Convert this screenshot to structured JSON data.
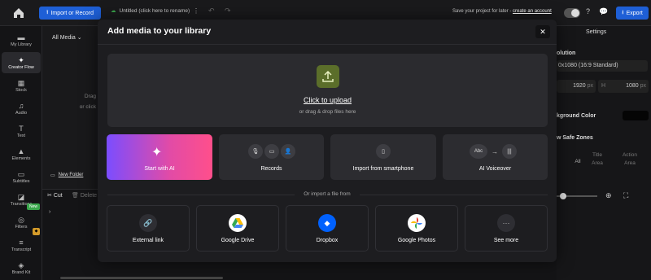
{
  "topbar": {
    "import_label": "Import or Record",
    "project_title": "Untitled (click here to rename)",
    "save_prompt": "Save your project for later - ",
    "create_account": "create an account",
    "export_label": "Export"
  },
  "sidebar": {
    "items": [
      {
        "label": "My Library",
        "icon": "folder-icon"
      },
      {
        "label": "Creator Flow",
        "icon": "sparkle-icon"
      },
      {
        "label": "Stock",
        "icon": "grid-icon"
      },
      {
        "label": "Audio",
        "icon": "music-icon"
      },
      {
        "label": "Text",
        "icon": "text-icon"
      },
      {
        "label": "Elements",
        "icon": "shapes-icon"
      },
      {
        "label": "Subtitles",
        "icon": "cc-icon"
      },
      {
        "label": "Transitions",
        "icon": "transition-icon"
      },
      {
        "label": "Filters",
        "icon": "filter-icon"
      },
      {
        "label": "Transcript",
        "icon": "transcript-icon"
      },
      {
        "label": "Brand Kit",
        "icon": "brand-icon"
      }
    ],
    "new_badge": "New"
  },
  "library": {
    "filter": "All Media",
    "drop_text_1": "Drag",
    "drop_text_2": "or click",
    "new_folder": "New Folder"
  },
  "right_panel": {
    "title": "Settings",
    "resolution_label": "olution",
    "resolution_value": "0x1080 (16:9 Standard)",
    "width_value": "1920",
    "width_unit": "px",
    "height_label": "H",
    "height_value": "1080",
    "height_unit": "px",
    "bg_label": "kground Color",
    "safe_label": "w Safe Zones",
    "safe_all": "All",
    "safe_title": "Title Area",
    "safe_action": "Action Area"
  },
  "timeline": {
    "cut_label": "Cut",
    "delete_label": "Delete"
  },
  "modal": {
    "title": "Add media to your library",
    "close": "✕",
    "upload_main": "Click to upload",
    "upload_sub": "or drag & drop files here",
    "options": [
      {
        "label": "Start with AI"
      },
      {
        "label": "Records"
      },
      {
        "label": "Import from smartphone"
      },
      {
        "label": "AI Voiceover"
      }
    ],
    "voiceover_abc": "Abc",
    "or_import": "Or import a file from",
    "sources": [
      {
        "label": "External link"
      },
      {
        "label": "Google Drive"
      },
      {
        "label": "Dropbox"
      },
      {
        "label": "Google Photos"
      },
      {
        "label": "See more"
      }
    ]
  },
  "colors": {
    "accent": "#1e5fd6",
    "upload_icon_bg": "#5b6e2a",
    "ai_gradient_start": "#7b4dff",
    "ai_gradient_end": "#ff4f8b",
    "new_badge": "#3aa84c"
  }
}
